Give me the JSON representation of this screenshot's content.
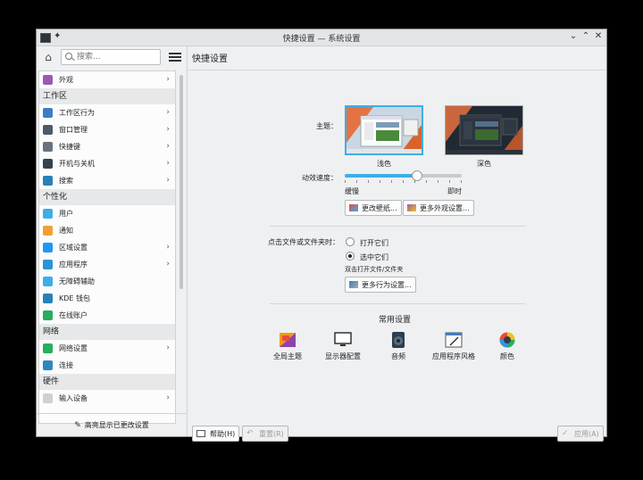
{
  "window": {
    "title": "快捷设置 — 系统设置"
  },
  "titlebar_icons": [
    "app-icon",
    "pin-icon",
    "minimize-icon",
    "maximize-icon",
    "close-icon"
  ],
  "sidebar": {
    "search_placeholder": "搜索...",
    "items": [
      {
        "type": "item",
        "label": "外观",
        "icon": "appearance-icon",
        "color": "#9b59b6",
        "chevron": true
      },
      {
        "type": "category",
        "label": "工作区"
      },
      {
        "type": "item",
        "label": "工作区行为",
        "icon": "workspace-icon",
        "color": "#3d7fc4",
        "chevron": true
      },
      {
        "type": "item",
        "label": "窗口管理",
        "icon": "window-icon",
        "color": "#4d5a67",
        "chevron": true
      },
      {
        "type": "item",
        "label": "快捷键",
        "icon": "keyboard-icon",
        "color": "#6a737b",
        "chevron": true
      },
      {
        "type": "item",
        "label": "开机与关机",
        "icon": "startup-icon",
        "color": "#36424e",
        "chevron": true
      },
      {
        "type": "item",
        "label": "搜索",
        "icon": "search-icon",
        "color": "#2980b9",
        "chevron": true
      },
      {
        "type": "category",
        "label": "个性化"
      },
      {
        "type": "item",
        "label": "用户",
        "icon": "user-icon",
        "color": "#3daee9",
        "chevron": false
      },
      {
        "type": "item",
        "label": "通知",
        "icon": "bell-icon",
        "color": "#f0a030",
        "chevron": false
      },
      {
        "type": "item",
        "label": "区域设置",
        "icon": "region-icon",
        "color": "#1d99f3",
        "chevron": true
      },
      {
        "type": "item",
        "label": "应用程序",
        "icon": "applications-icon",
        "color": "#2a94d6",
        "chevron": true
      },
      {
        "type": "item",
        "label": "无障碍辅助",
        "icon": "accessibility-icon",
        "color": "#3daee9",
        "chevron": false
      },
      {
        "type": "item",
        "label": "KDE 钱包",
        "icon": "wallet-icon",
        "color": "#2980b9",
        "chevron": false
      },
      {
        "type": "item",
        "label": "在线账户",
        "icon": "globe-icon",
        "color": "#27ae60",
        "chevron": false
      },
      {
        "type": "category",
        "label": "网络"
      },
      {
        "type": "item",
        "label": "网络设置",
        "icon": "network-icon",
        "color": "#27ae60",
        "chevron": true
      },
      {
        "type": "item",
        "label": "连接",
        "icon": "connect-icon",
        "color": "#2e86c1",
        "chevron": false
      },
      {
        "type": "category",
        "label": "硬件"
      },
      {
        "type": "item",
        "label": "输入设备",
        "icon": "mouse-icon",
        "color": "#d0d0d0",
        "chevron": true
      }
    ],
    "footer": "高亮显示已更改设置"
  },
  "main": {
    "title": "快捷设置",
    "theme_label": "主题：",
    "themes": [
      {
        "caption": "浅色",
        "selected": true
      },
      {
        "caption": "深色",
        "selected": false
      }
    ],
    "anim_label": "动效速度：",
    "anim_slow": "缓慢",
    "anim_instant": "即时",
    "anim_position": 0.62,
    "btn_wallpaper": "更改壁纸...",
    "btn_more_appearance": "更多外观设置...",
    "click_label": "点击文件或文件夹时：",
    "radio_open": "打开它们",
    "radio_select": "选中它们",
    "click_hint": "双击打开文件/文件夹",
    "btn_more_behavior": "更多行为设置...",
    "common_title": "常用设置",
    "common": [
      {
        "label": "全局主题",
        "icon": "global-theme-icon"
      },
      {
        "label": "显示器配置",
        "icon": "display-icon"
      },
      {
        "label": "音频",
        "icon": "audio-icon"
      },
      {
        "label": "应用程序风格",
        "icon": "app-style-icon"
      },
      {
        "label": "颜色",
        "icon": "colors-icon"
      }
    ],
    "help": "帮助(H)",
    "reset": "重置(R)",
    "apply": "应用(A)"
  },
  "colors": {
    "accent": "#3daee9",
    "window_bg": "#eff0f1"
  }
}
